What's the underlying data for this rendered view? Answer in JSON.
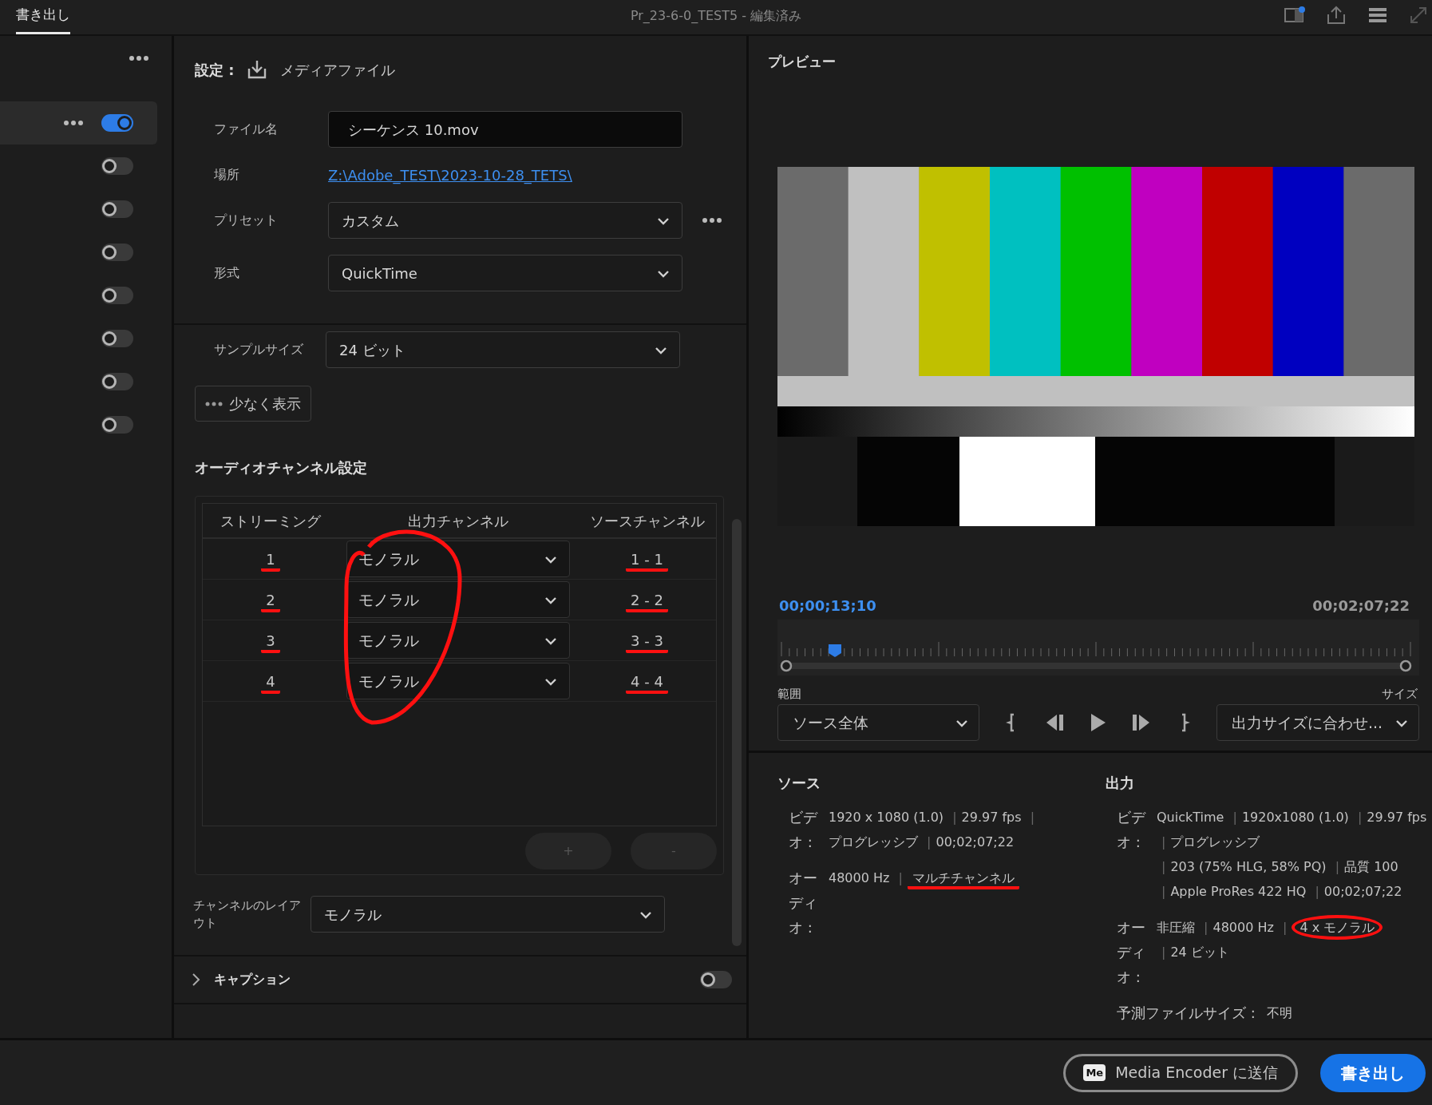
{
  "top_bar": {
    "tab": {
      "label": "書き出し",
      "selected": true
    },
    "title": "Pr_23-6-0_TEST5",
    "title_suffix": " - 編集済み"
  },
  "sidebar": {
    "items": [
      {
        "selected": true,
        "on": true
      },
      {
        "selected": false,
        "on": false
      },
      {
        "selected": false,
        "on": false
      },
      {
        "selected": false,
        "on": false
      },
      {
        "selected": false,
        "on": false
      },
      {
        "selected": false,
        "on": false
      },
      {
        "selected": false,
        "on": false
      },
      {
        "selected": false,
        "on": false
      }
    ]
  },
  "settings": {
    "heading": "設定 :",
    "target": "メディアファイル",
    "fields": [
      {
        "kind": "input",
        "label": "ファイル名",
        "value": "シーケンス 10.mov"
      },
      {
        "kind": "link",
        "label": "場所",
        "value": "Z:\\Adobe_TEST\\2023-10-28_TETS\\"
      },
      {
        "kind": "select",
        "label": "プリセット",
        "value": "カスタム",
        "more": true
      },
      {
        "kind": "select",
        "label": "形式",
        "value": "QuickTime",
        "more": false
      }
    ],
    "sample_size": {
      "label": "サンプルサイズ",
      "value": "24 ビット"
    },
    "show_less": "少なく表示",
    "audio_heading": "オーディオチャンネル設定",
    "table": {
      "columns": [
        {
          "label": "ストリーミング",
          "underlined": true
        },
        {
          "label": "出力チャンネル",
          "circled": true
        },
        {
          "label": "ソースチャンネル",
          "underlined": true
        }
      ],
      "rows": [
        {
          "stream": "1",
          "output": "モノラル",
          "source": "1 - 1"
        },
        {
          "stream": "2",
          "output": "モノラル",
          "source": "2 - 2"
        },
        {
          "stream": "3",
          "output": "モノラル",
          "source": "3 - 3"
        },
        {
          "stream": "4",
          "output": "モノラル",
          "source": "4 - 4"
        }
      ],
      "buttons": [
        {
          "label": "+",
          "disabled": true
        },
        {
          "label": "-",
          "disabled": true
        }
      ]
    },
    "layout": {
      "label": "チャンネルのレイアウト",
      "value": "モノラル"
    },
    "caption": {
      "label": "キャプション",
      "expanded": false,
      "on": false
    }
  },
  "preview": {
    "heading": "プレビュー",
    "current_time": "00;00;13;10",
    "duration": "00;02;07;22",
    "playhead": {
      "level": 0.09
    },
    "range": {
      "label": "範囲",
      "value": "ソース全体"
    },
    "size": {
      "label": "サイズ",
      "value": "出力サイズに合わせ..."
    }
  },
  "info": {
    "source": {
      "heading": "ソース",
      "rows": [
        {
          "label": "ビデオ :",
          "parts": [
            {
              "text": "1920 x 1080 (1.0)"
            },
            {
              "sep": "|",
              "text": "29.97 fps"
            },
            {
              "sep": "|",
              "text": "プログレッシブ"
            },
            {
              "sep": "|",
              "text": "00;02;07;22"
            }
          ]
        },
        {
          "label": "オーディオ :",
          "parts": [
            {
              "text": "48000 Hz"
            },
            {
              "sep": "|",
              "text": "マルチチャンネル",
              "underlined": true
            }
          ]
        }
      ]
    },
    "output": {
      "heading": "出力",
      "rows": [
        {
          "label": "ビデオ :",
          "parts": [
            {
              "text": "QuickTime"
            },
            {
              "sep": "|",
              "text": "1920x1080 (1.0)"
            },
            {
              "sep": "|",
              "text": "29.97 fps"
            },
            {
              "sep": "|",
              "text": "プログレッシブ"
            },
            {
              "sep": "|",
              "text": "203 (75% HLG, 58% PQ)"
            },
            {
              "sep": "|",
              "text": "品質 100"
            },
            {
              "sep": "|",
              "text": "Apple ProRes 422 HQ"
            },
            {
              "sep": "|",
              "text": "00;02;07;22"
            }
          ]
        },
        {
          "label": "オーディオ :",
          "parts": [
            {
              "text": "非圧縮"
            },
            {
              "sep": "|",
              "text": "48000 Hz"
            },
            {
              "sep": "|",
              "text": "4 x モノラル",
              "circled": true
            },
            {
              "sep": "|",
              "text": "24 ビット"
            }
          ]
        },
        {
          "label": "予測ファイルサイズ :",
          "parts": [
            {
              "text": "不明"
            }
          ]
        }
      ]
    }
  },
  "footer": {
    "send": {
      "badge": "Me",
      "label": "Media Encoder に送信"
    },
    "export": "書き出し"
  }
}
